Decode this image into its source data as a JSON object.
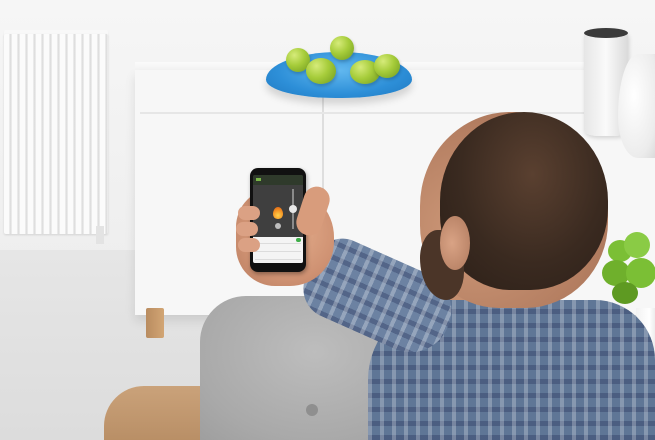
{
  "scene": {
    "radiator": "radiator",
    "sideboard": "sideboard",
    "fruit_bowl": "fruit-bowl",
    "smart_speaker": "smart-speaker",
    "plant": "potted-plant",
    "couch": "couch",
    "person": "man-holding-phone"
  },
  "phone": {
    "screen_title": "",
    "temp_label": "",
    "icon": "flame-icon",
    "rows": [
      "",
      "",
      ""
    ],
    "accent_color": "#7ab648",
    "flame_color": "#f39022",
    "toggle_color": "#3fae49"
  },
  "colors": {
    "bowl": "#2d8fd8",
    "apples": "#a6cc3a",
    "shirt": "#5f7696",
    "wall": "#f2f2f2"
  }
}
